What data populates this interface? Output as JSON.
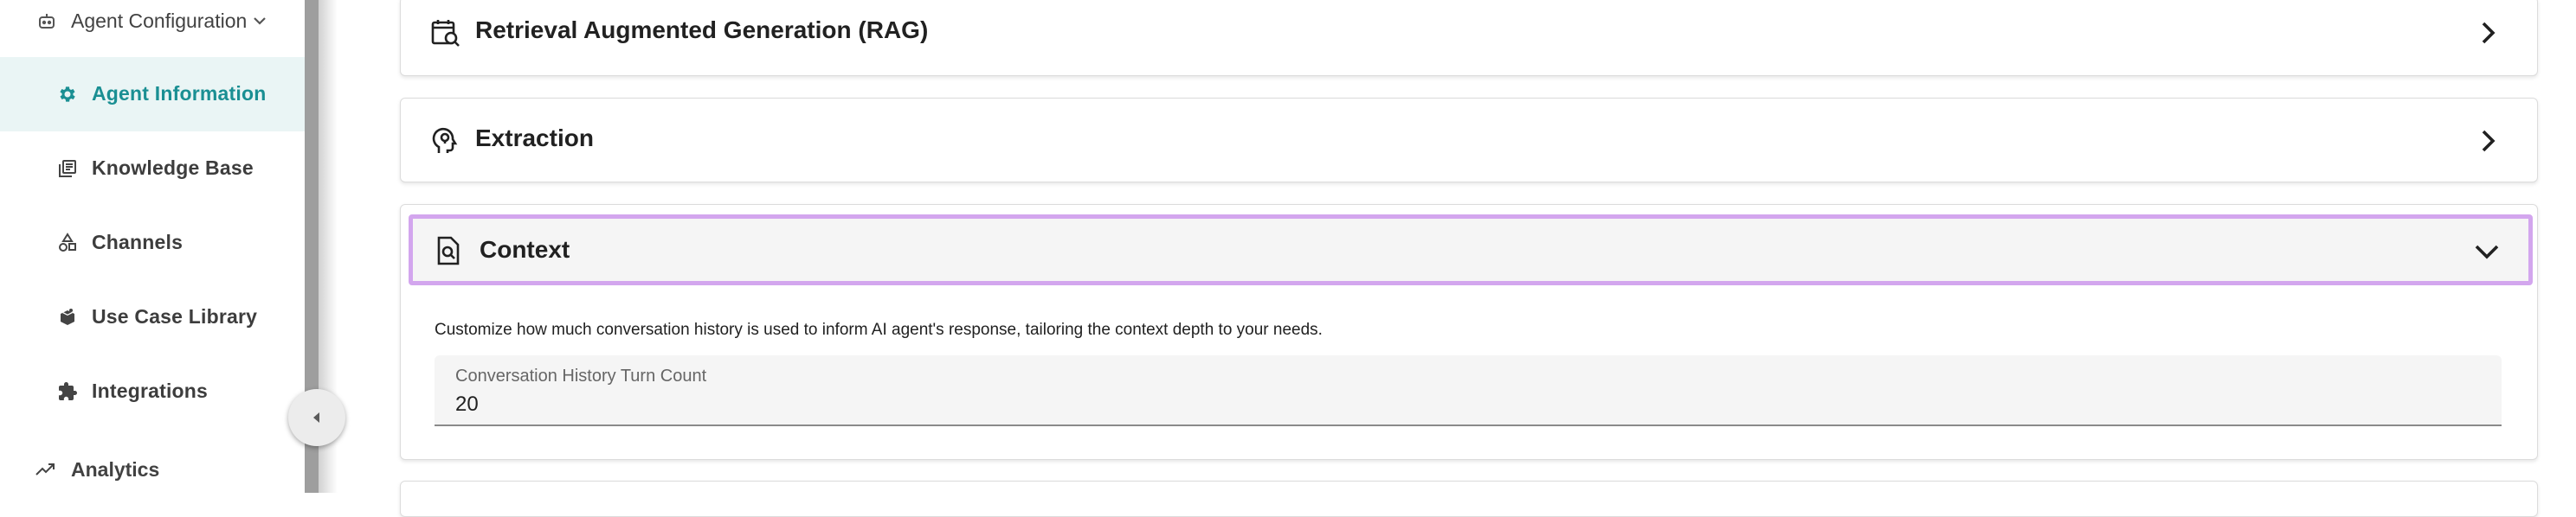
{
  "sidebar": {
    "group_label": "Agent Configuration",
    "items": [
      {
        "label": "Agent Information",
        "icon": "gear-icon",
        "active": true
      },
      {
        "label": "Knowledge Base",
        "icon": "book-icon"
      },
      {
        "label": "Channels",
        "icon": "shapes-icon"
      },
      {
        "label": "Use Case Library",
        "icon": "package-icon"
      },
      {
        "label": "Integrations",
        "icon": "puzzle-icon"
      }
    ],
    "analytics_label": "Analytics",
    "active_color": "#1a8f93",
    "active_bg": "#eaf5f5"
  },
  "panels": {
    "rag": {
      "title": "Retrieval Augmented Generation (RAG)",
      "icon": "calendar-search-icon"
    },
    "extraction": {
      "title": "Extraction",
      "icon": "head-lightbulb-icon"
    },
    "context": {
      "title": "Context",
      "icon": "document-search-icon",
      "description": "Customize how much conversation history is used to inform AI agent's response, tailoring the context depth to your needs.",
      "field_label": "Conversation History Turn Count",
      "field_value": "20",
      "highlight_color": "#d3a6ee"
    }
  }
}
